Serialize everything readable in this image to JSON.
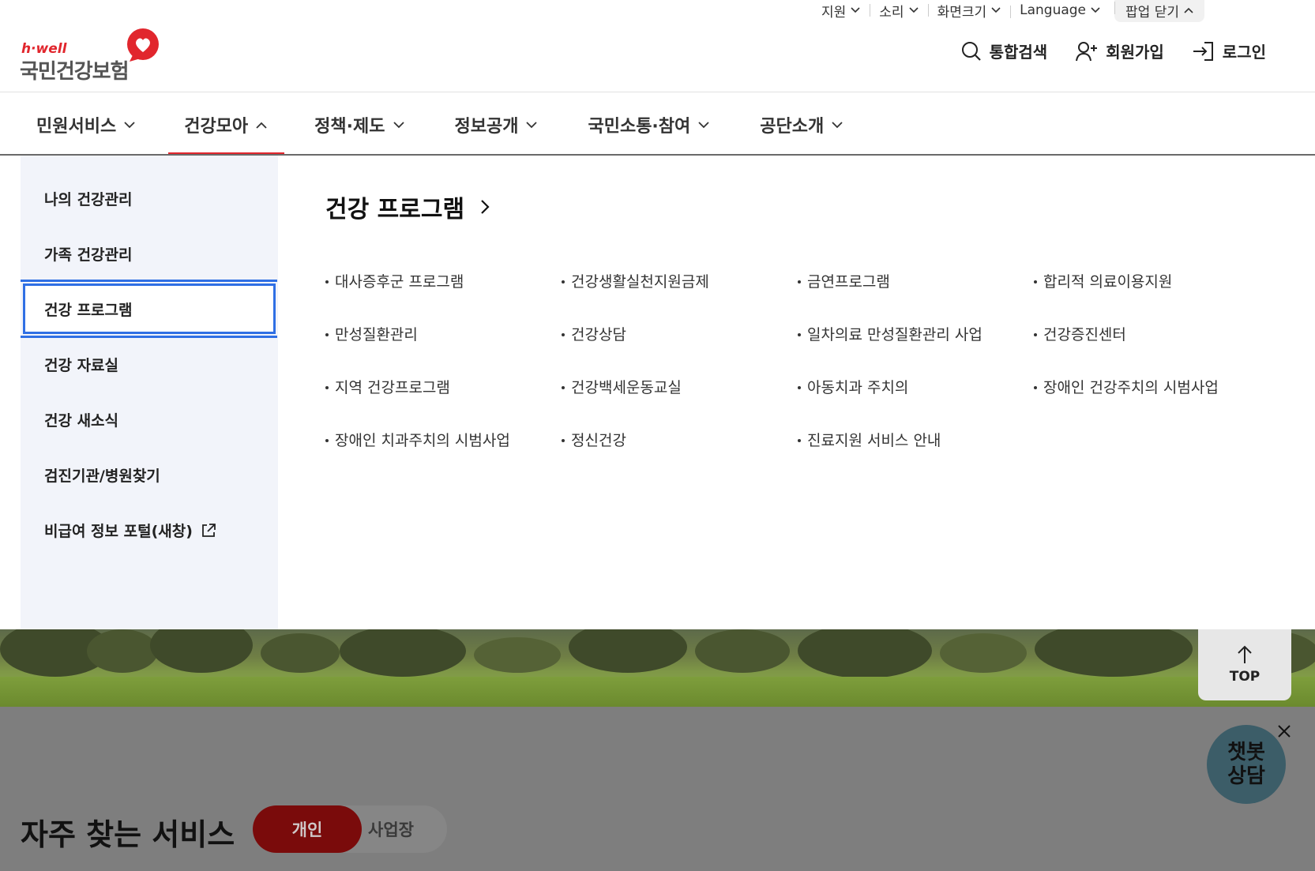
{
  "utility": {
    "support": "지원",
    "sound": "소리",
    "screen_size": "화면크기",
    "language": "Language",
    "popup_close": "팝업 닫기"
  },
  "logo": {
    "sub": "h·well",
    "main": "국민건강보험"
  },
  "header_actions": {
    "search": "통합검색",
    "signup": "회원가입",
    "login": "로그인"
  },
  "gnb": [
    {
      "label": "민원서비스",
      "expanded": false
    },
    {
      "label": "건강모아",
      "expanded": true
    },
    {
      "label": "정책·제도",
      "expanded": false
    },
    {
      "label": "정보공개",
      "expanded": false
    },
    {
      "label": "국민소통·참여",
      "expanded": false
    },
    {
      "label": "공단소개",
      "expanded": false
    }
  ],
  "side_menu": [
    "나의 건강관리",
    "가족 건강관리",
    "건강 프로그램",
    "건강 자료실",
    "건강 새소식",
    "검진기관/병원찾기",
    "비급여 정보 포털(새창)"
  ],
  "section_title": "건강 프로그램",
  "links": [
    "대사증후군 프로그램",
    "건강생활실천지원금제",
    "금연프로그램",
    "합리적 의료이용지원",
    "만성질환관리",
    "건강상담",
    "일차의료 만성질환관리 사업",
    "건강증진센터",
    "지역 건강프로그램",
    "건강백세운동교실",
    "아동치과 주치의",
    "장애인 건강주치의 시범사업",
    "장애인 치과주치의 시범사업",
    "정신건강",
    "진료지원 서비스 안내"
  ],
  "top_button": "TOP",
  "chatbot": {
    "line1": "챗봇",
    "line2": "상담"
  },
  "faq": {
    "title": "자주 찾는 서비스",
    "tab_personal": "개인",
    "tab_business": "사업장"
  },
  "colors": {
    "brand_red": "#e1262d",
    "focus_blue": "#2f6fe4",
    "side_bg": "#f2f4fa"
  }
}
